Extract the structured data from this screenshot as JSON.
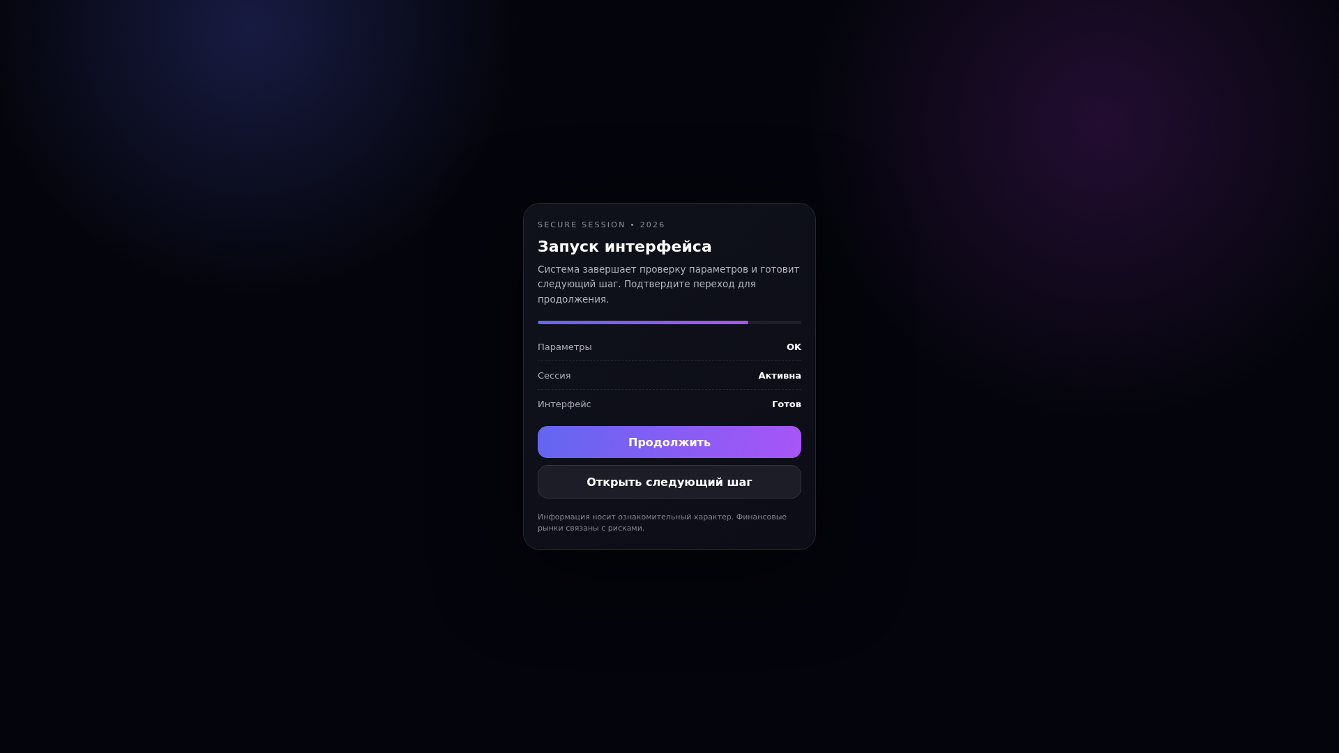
{
  "card": {
    "eyebrow": "SECURE SESSION • 2026",
    "title": "Запуск интерфейса",
    "description": "Система завершает проверку параметров и готовит следующий шаг. Подтвердите переход для продолжения.",
    "progress": {
      "level": 0.8
    },
    "status_rows": [
      {
        "label": "Параметры",
        "value": "OK"
      },
      {
        "label": "Сессия",
        "value": "Активна"
      },
      {
        "label": "Интерфейс",
        "value": "Готов"
      }
    ],
    "buttons": [
      {
        "label": "Продолжить",
        "kind": "primary"
      },
      {
        "label": "Открыть следующий шаг",
        "kind": "secondary"
      }
    ],
    "disclaimer": "Информация носит ознакомительный характер. Финансовые рынки связаны с рисками."
  }
}
